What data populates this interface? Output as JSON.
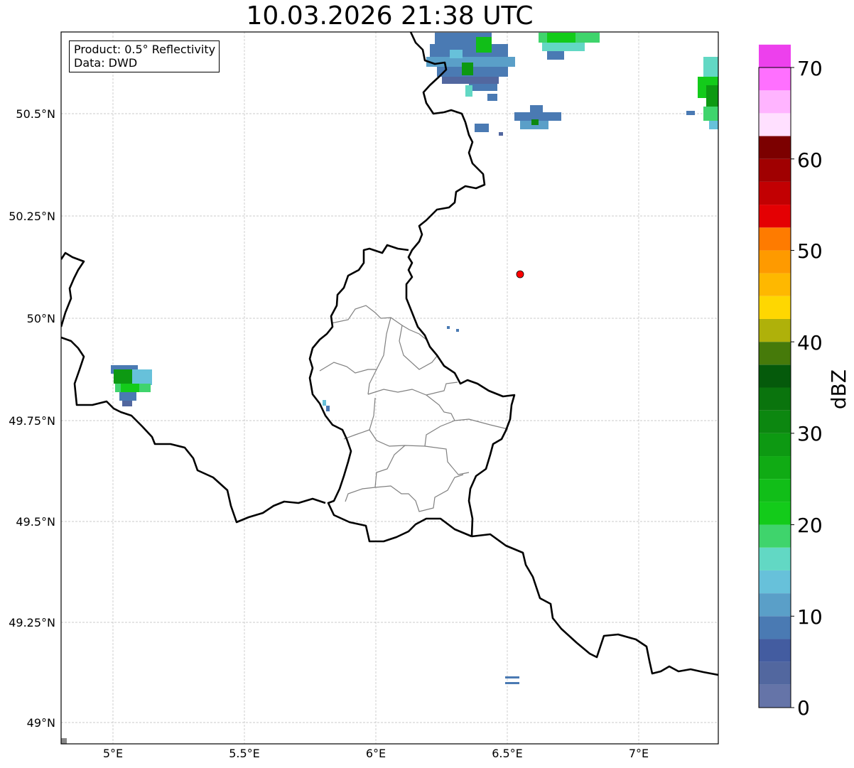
{
  "title": "10.03.2026 21:38 UTC",
  "info": {
    "product": "Product: 0.5° Reflectivity",
    "data_source": "Data: DWD"
  },
  "axes": {
    "x_ticks": [
      "5°E",
      "5.5°E",
      "6°E",
      "6.5°E",
      "7°E"
    ],
    "y_ticks": [
      "50.5°N",
      "50.25°N",
      "50°N",
      "49.75°N",
      "49.5°N",
      "49.25°N",
      "49°N"
    ]
  },
  "colorbar": {
    "label": "dBZ",
    "ticks": [
      "0",
      "10",
      "20",
      "30",
      "40",
      "50",
      "60",
      "70"
    ],
    "min": 0,
    "max": 70,
    "step": 2.5,
    "colors": [
      "#6574a8",
      "#52679f",
      "#435ca0",
      "#4a7ab3",
      "#5a9fc8",
      "#67c1da",
      "#62d8c4",
      "#3fd46c",
      "#13cb1a",
      "#11be18",
      "#10ab14",
      "#0d9912",
      "#0c8710",
      "#0a740d",
      "#055a0b",
      "#467a0a",
      "#afb10a",
      "#fed701",
      "#feb800",
      "#fe9a00",
      "#fe7b00",
      "#e40003",
      "#c20002",
      "#a00001",
      "#7c0000",
      "#ffe0ff",
      "#ffb4ff",
      "#ff70ff",
      "#ed40ed"
    ]
  },
  "map": {
    "marker": {
      "lon": 6.55,
      "lat": 50.11,
      "color": "#ff0000"
    },
    "lon_range": [
      4.8,
      7.3
    ],
    "lat_range": [
      48.95,
      50.7
    ]
  }
}
